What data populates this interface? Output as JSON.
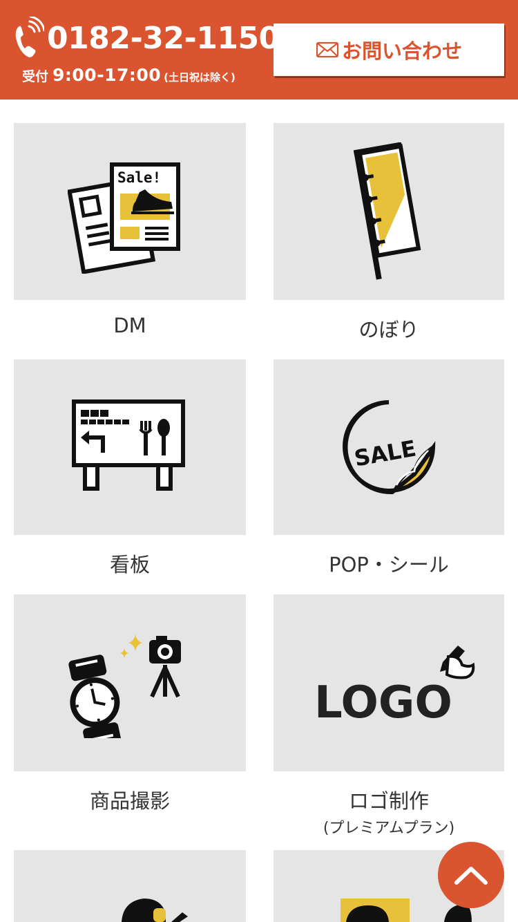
{
  "header": {
    "phone_number": "0182-32-1150",
    "hours_label": "受付",
    "hours_time": "9:00-17:00",
    "hours_note": "(土日祝は除く)",
    "contact_label": "お問い合わせ"
  },
  "tiles": [
    {
      "title": "DM",
      "subtitle": ""
    },
    {
      "title": "のぼり",
      "subtitle": ""
    },
    {
      "title": "看板",
      "subtitle": ""
    },
    {
      "title": "POP・シール",
      "subtitle": ""
    },
    {
      "title": "商品撮影",
      "subtitle": ""
    },
    {
      "title": "ロゴ制作",
      "subtitle": "(プレミアムプラン)"
    }
  ],
  "illustrations": {
    "dm_sign": "Sale!",
    "sticker_text": "SALE",
    "logo_text": "LOGO"
  },
  "icons": [
    "phone-icon",
    "mail-icon",
    "chevron-up-icon",
    "dm-flyer-icon",
    "nobori-flag-icon",
    "signboard-icon",
    "sale-sticker-icon",
    "product-photo-icon",
    "logo-design-icon"
  ],
  "colors": {
    "brand": "#d9542f",
    "accent": "#e8c13a",
    "tile_bg": "#e5e5e5"
  }
}
